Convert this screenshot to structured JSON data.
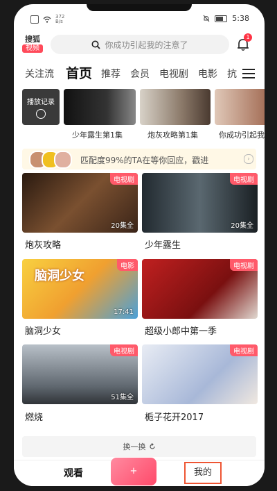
{
  "status_bar": {
    "network_speed_top": "372",
    "network_speed_bottom": "B/s",
    "time": "5:38"
  },
  "header": {
    "logo_line1": "搜狐",
    "logo_line2": "视频",
    "search_placeholder": "你成功引起我的注意了",
    "notification_count": "1"
  },
  "tabs": [
    {
      "label": "关注流"
    },
    {
      "label": "首页"
    },
    {
      "label": "推荐"
    },
    {
      "label": "会员"
    },
    {
      "label": "电视剧"
    },
    {
      "label": "电影"
    },
    {
      "label": "抗"
    }
  ],
  "history": {
    "first_label": "播放记录",
    "items": [
      {
        "caption": "少年露生第1集"
      },
      {
        "caption": "炮灰攻略第1集"
      },
      {
        "caption": "你成功引起我"
      }
    ]
  },
  "match_banner": {
    "text": "匹配度99%的TA在等你回应，戳进"
  },
  "cards": [
    {
      "title": "炮灰攻略",
      "tag": "电视剧",
      "duration": "20集全",
      "color": "#5a3a28"
    },
    {
      "title": "少年露生",
      "tag": "电视剧",
      "duration": "20集全",
      "color": "#3a4248"
    },
    {
      "title": "脑洞少女",
      "tag": "电影",
      "duration": "17:41",
      "color": "#e8a030",
      "poster_text": "脑洞少女"
    },
    {
      "title": "超级小郎中第一季",
      "tag": "电视剧",
      "duration": "",
      "color": "#b01e1e"
    },
    {
      "title": "燃烧",
      "tag": "电视剧",
      "duration": "51集全",
      "color": "#a0a8b0"
    },
    {
      "title": "栀子花开2017",
      "tag": "电视剧",
      "duration": "",
      "color": "#d8dce4"
    }
  ],
  "refresh": {
    "label": "换一换"
  },
  "bottom_nav": {
    "watch": "观看",
    "center": "",
    "mine": "我的"
  }
}
